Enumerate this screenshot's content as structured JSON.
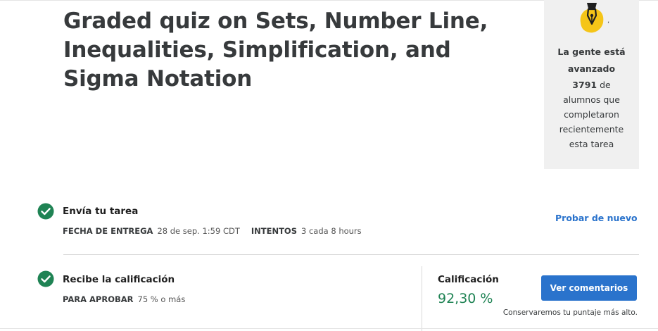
{
  "assignment": {
    "title": "Graded quiz on Sets, Number Line, Inequalities, Simplification, and Sigma Notation"
  },
  "side_card": {
    "icon": "pen-nib-icon",
    "heading": "La gente está avanzado",
    "count": "3791",
    "line1": "de",
    "line2": "alumnos que completaron recientemente esta tarea"
  },
  "submit_step": {
    "title": "Envía tu tarea",
    "due_key": "FECHA DE ENTREGA",
    "due_value": "28 de sep. 1:59 CDT",
    "attempts_key": "INTENTOS",
    "attempts_value": "3 cada 8 hours",
    "retry_label": "Probar de nuevo",
    "status_icon": "check-circle-icon"
  },
  "grade_step": {
    "title": "Recibe la calificación",
    "pass_key": "PARA APROBAR",
    "pass_value": "75 % o más",
    "grade_label": "Calificación",
    "grade_value": "92,30 %",
    "feedback_button": "Ver comentarios",
    "keep_note": "Conservaremos tu puntaje más alto.",
    "status_icon": "check-circle-icon"
  },
  "colors": {
    "accent_blue": "#2a73cc",
    "success_green": "#1f8354",
    "badge_yellow": "#f5c518",
    "card_bg": "#f0f0f0"
  }
}
